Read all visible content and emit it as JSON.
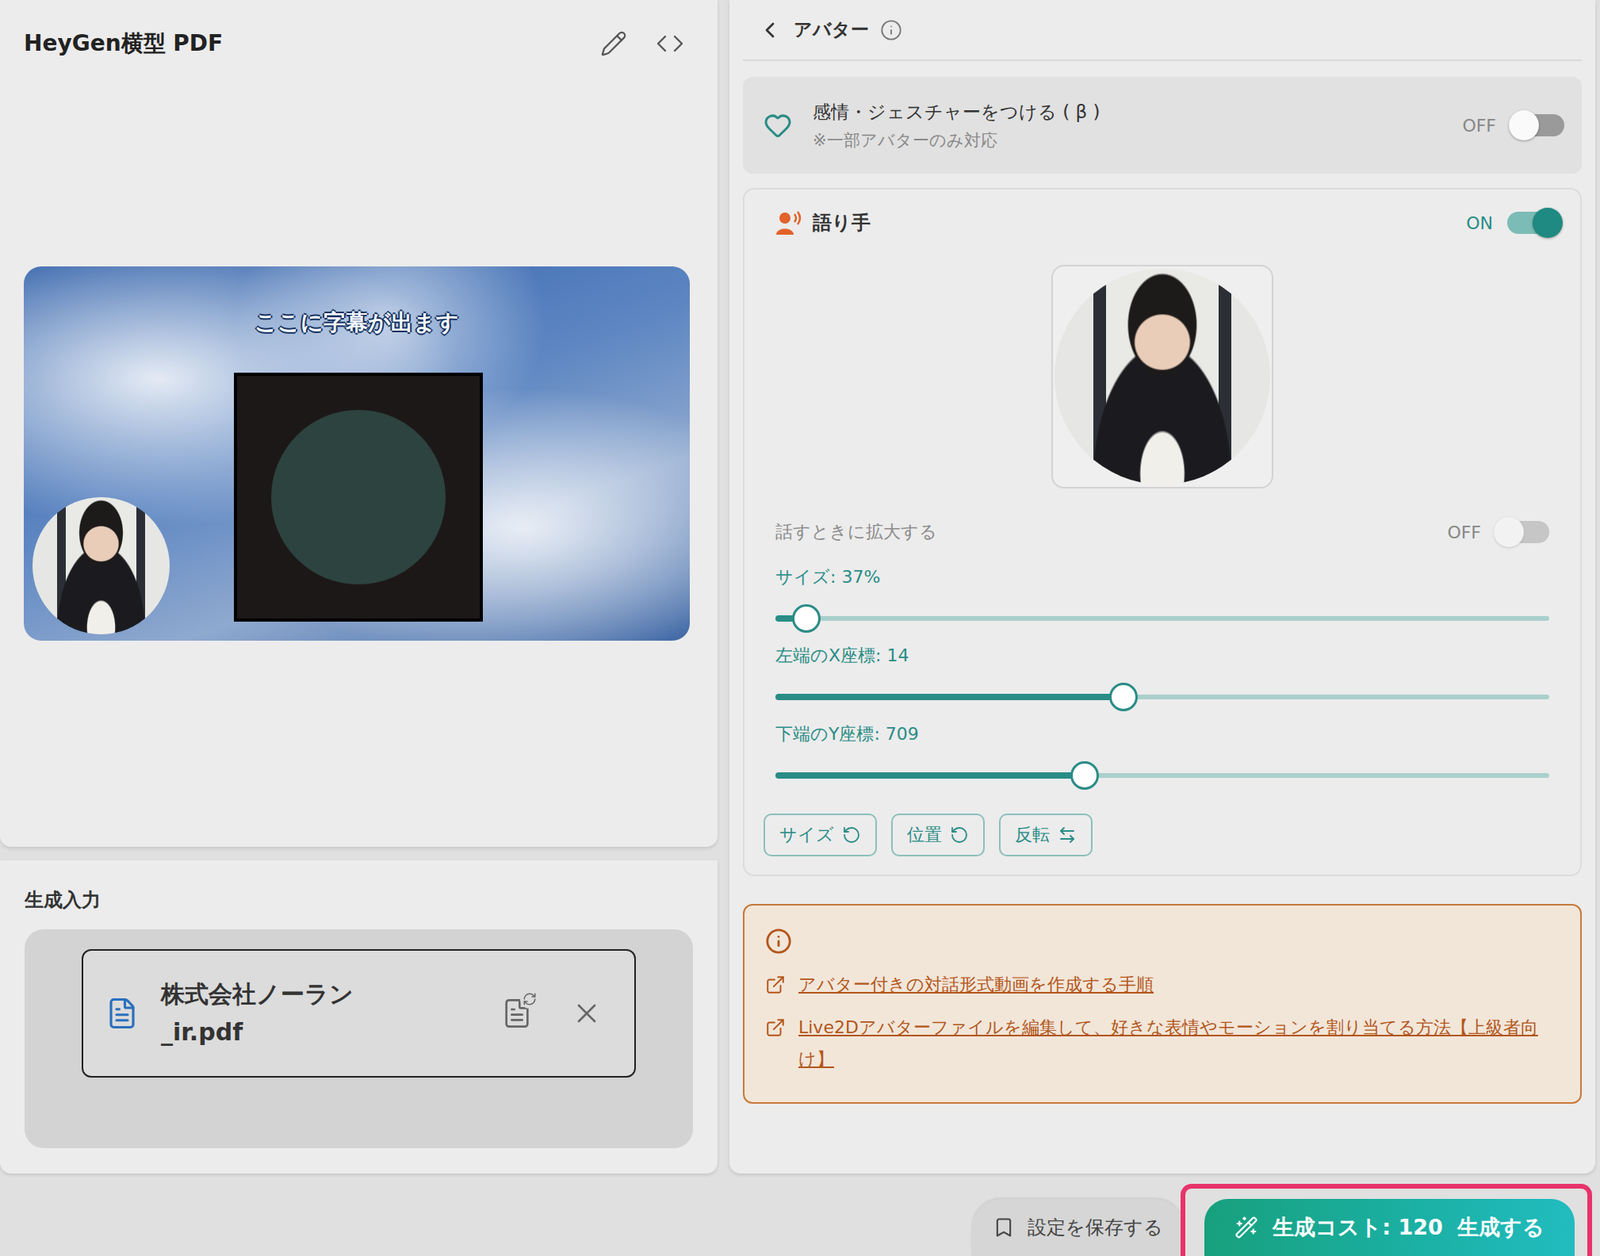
{
  "editor": {
    "title": "HeyGen横型 PDF",
    "subtitle": "ここに字幕が出ます"
  },
  "input": {
    "title": "生成入力",
    "file_lines": [
      "株式会社ノーラン",
      "_ir.pdf"
    ]
  },
  "panel": {
    "title": "アバター"
  },
  "emotion": {
    "title": "感情・ジェスチャーをつける ( β )",
    "note": "※一部アバターのみ対応",
    "state": "OFF",
    "on": false
  },
  "narrator": {
    "title": "語り手",
    "state": "ON",
    "on": true
  },
  "zoom": {
    "label": "話すときに拡大する",
    "state": "OFF",
    "on": false,
    "disabled": true
  },
  "sliders": [
    {
      "label": "サイズ: 37%",
      "level": 0.04
    },
    {
      "label": "左端のX座標: 14",
      "level": 0.45
    },
    {
      "label": "下端のY座標: 709",
      "level": 0.4
    }
  ],
  "reset_buttons": [
    {
      "label": "サイズ",
      "kind": "reset"
    },
    {
      "label": "位置",
      "kind": "reset"
    },
    {
      "label": "反転",
      "kind": "flip"
    }
  ],
  "links": [
    "アバター付きの対話形式動画を作成する手順",
    "Live2Dアバターファイルを編集して、好きな表情やモーションを割り当てる方法【上級者向け】"
  ],
  "footer": {
    "save": "設定を保存する",
    "cost": "生成コスト: 120",
    "generate": "生成する"
  }
}
